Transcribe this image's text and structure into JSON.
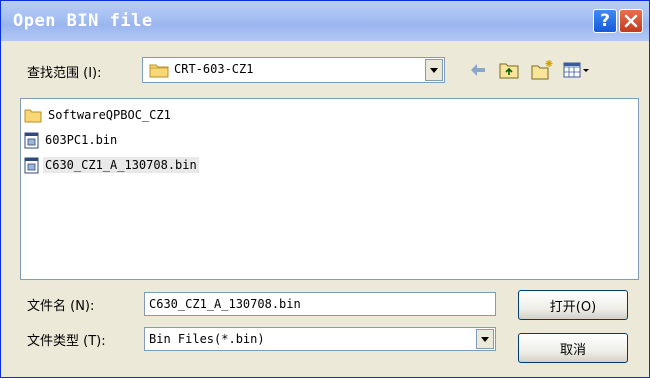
{
  "window": {
    "title": "Open BIN file",
    "help_label": "?"
  },
  "lookin": {
    "label": "查找范围 (I):",
    "value": "CRT-603-CZ1"
  },
  "files": [
    {
      "name": "SoftwareQPBOC_CZ1",
      "icon": "folder-icon",
      "selected": false
    },
    {
      "name": "603PC1.bin",
      "icon": "bin-file-icon",
      "selected": false
    },
    {
      "name": "C630_CZ1_A_130708.bin",
      "icon": "bin-file-icon",
      "selected": true
    }
  ],
  "filename": {
    "label": "文件名 (N):",
    "value": "C630_CZ1_A_130708.bin"
  },
  "filetype": {
    "label": "文件类型 (T):",
    "value": "Bin Files(*.bin)"
  },
  "buttons": {
    "open": "打开(O)",
    "cancel": "取消"
  },
  "colors": {
    "titlebar": "#a7c0f3",
    "dialog_bg": "#ece9d8",
    "close": "#c3391f",
    "help": "#1659d9"
  }
}
